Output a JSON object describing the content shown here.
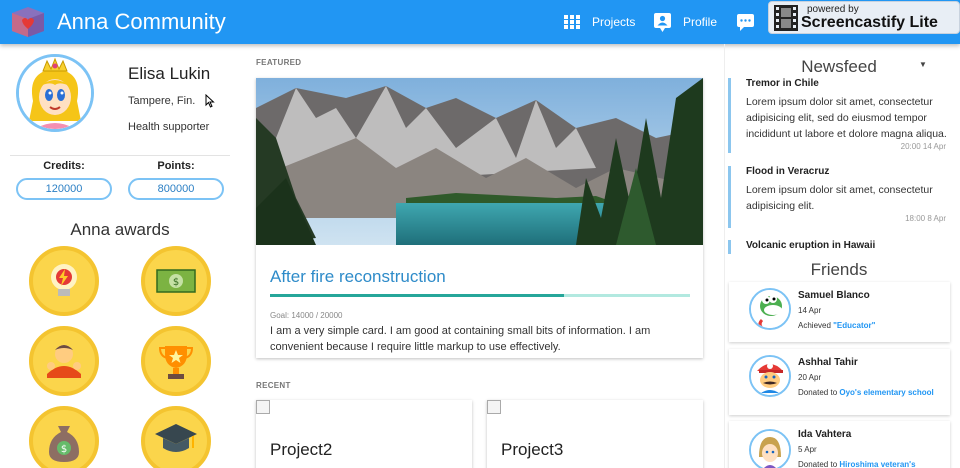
{
  "header": {
    "title": "Anna Community",
    "nav": [
      {
        "label": "Projects",
        "icon": "grid-icon"
      },
      {
        "label": "Profile",
        "icon": "profile-icon"
      },
      {
        "label": "",
        "icon": "chat-icon"
      }
    ],
    "watermark": {
      "small": "powered by",
      "big": "Screencastify Lite"
    }
  },
  "profile": {
    "name": "Elisa Lukin",
    "location": "Tampere, Fin.",
    "role": "Health supporter",
    "credits_label": "Credits:",
    "credits": "120000",
    "points_label": "Points:",
    "points": "800000"
  },
  "awards": {
    "title": "Anna awards",
    "items": [
      "lightbulb-award-icon",
      "money-award-icon",
      "team-award-icon",
      "trophy-award-icon",
      "moneybag-award-icon",
      "graduation-cap-award-icon"
    ]
  },
  "featured": {
    "label": "FEATURED",
    "title": "After fire reconstruction",
    "progress": 0.7,
    "goal": "Goal: 14000 / 20000",
    "description": "I am a very simple card. I am good at containing small bits of information. I am convenient because I require little markup to use effectively."
  },
  "recent": {
    "label": "RECENT",
    "items": [
      {
        "title": "Project2"
      },
      {
        "title": "Project3"
      }
    ]
  },
  "newsfeed": {
    "title": "Newsfeed",
    "items": [
      {
        "title": "Tremor in Chile",
        "body": "Lorem ipsum dolor sit amet, consectetur adipisicing elit, sed do eiusmod tempor incididunt ut labore et dolore magna aliqua.",
        "date": "20:00 14 Apr"
      },
      {
        "title": "Flood in Veracruz",
        "body": "Lorem ipsum dolor sit amet, consectetur adipisicing elit.",
        "date": "18:00 8 Apr"
      },
      {
        "title": "Volcanic eruption in Hawaii",
        "body": "",
        "date": ""
      }
    ]
  },
  "friends": {
    "title": "Friends",
    "items": [
      {
        "name": "Samuel Blanco",
        "date": "14 Apr",
        "action": "Achieved ",
        "link": "\"Educator\""
      },
      {
        "name": "Ashhal Tahir",
        "date": "20 Apr",
        "action": "Donated to ",
        "link": "Oyo's elementary school"
      },
      {
        "name": "Ida Vahtera",
        "date": "5 Apr",
        "action": "Donated to ",
        "link": "Hiroshima veteran's"
      }
    ]
  },
  "colors": {
    "primary": "#2196f3",
    "award": "#fbd54b",
    "progress": "#26a69a",
    "accent_text": "#2e8bc9"
  }
}
